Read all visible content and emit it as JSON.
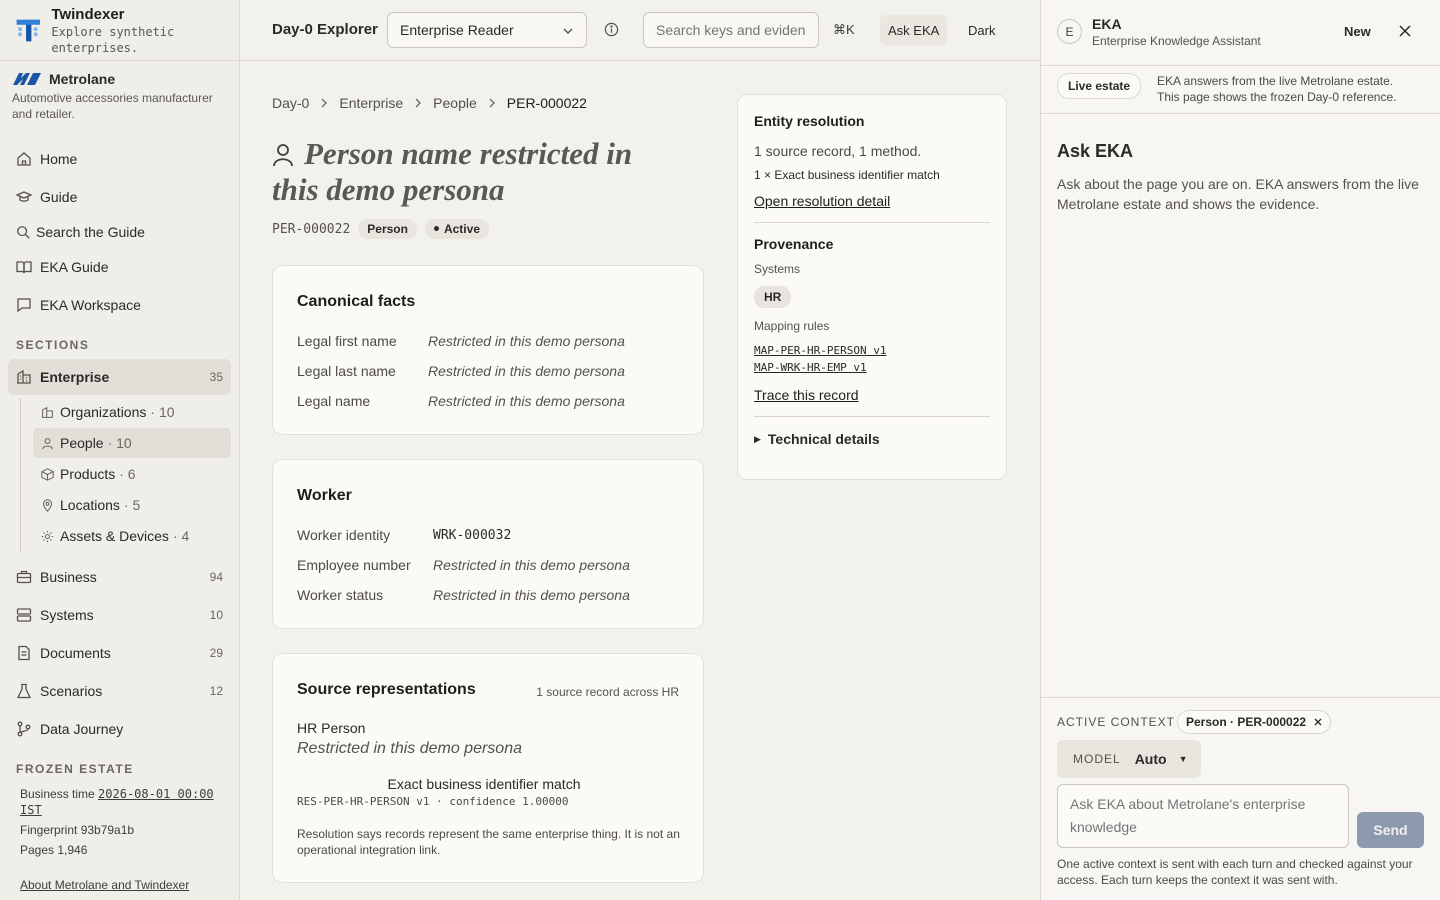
{
  "brand": {
    "name": "Twindexer",
    "tagline": "Explore synthetic enterprises."
  },
  "company": {
    "name": "Metrolane",
    "description": "Automotive accessories manufacturer and retailer."
  },
  "nav": {
    "home": "Home",
    "guide": "Guide",
    "search_guide": "Search the Guide",
    "eka_guide": "EKA Guide",
    "eka_workspace": "EKA Workspace"
  },
  "sections_label": "SECTIONS",
  "sections": {
    "enterprise": {
      "label": "Enterprise",
      "count": "35"
    },
    "organizations": {
      "label": "Organizations",
      "count": "· 10"
    },
    "people": {
      "label": "People",
      "count": "· 10"
    },
    "products": {
      "label": "Products",
      "count": "· 6"
    },
    "locations": {
      "label": "Locations",
      "count": "· 5"
    },
    "assets": {
      "label": "Assets & Devices",
      "count": "· 4"
    },
    "business": {
      "label": "Business",
      "count": "94"
    },
    "systems": {
      "label": "Systems",
      "count": "10"
    },
    "documents": {
      "label": "Documents",
      "count": "29"
    },
    "scenarios": {
      "label": "Scenarios",
      "count": "12"
    },
    "journey": {
      "label": "Data Journey"
    }
  },
  "frozen": {
    "label": "FROZEN ESTATE",
    "business_time_label": "Business time",
    "business_time": "2026-08-01 00:00 IST",
    "fingerprint": "Fingerprint 93b79a1b",
    "pages": "Pages 1,946",
    "about": "About Metrolane and Twindexer"
  },
  "topbar": {
    "title": "Day-0 Explorer",
    "persona": "Enterprise Reader",
    "search_placeholder": "Search keys and evidence",
    "shortcut": "⌘K",
    "ask": "Ask EKA",
    "dark": "Dark"
  },
  "breadcrumb": [
    "Day-0",
    "Enterprise",
    "People",
    "PER-000022"
  ],
  "page": {
    "title": "Person name restricted in this demo persona",
    "id": "PER-000022",
    "type_badge": "Person",
    "status_badge": "Active"
  },
  "canonical": {
    "title": "Canonical facts",
    "rows": [
      {
        "k": "Legal first name",
        "v": "Restricted in this demo persona"
      },
      {
        "k": "Legal last name",
        "v": "Restricted in this demo persona"
      },
      {
        "k": "Legal name",
        "v": "Restricted in this demo persona"
      }
    ]
  },
  "worker": {
    "title": "Worker",
    "rows": [
      {
        "k": "Worker identity",
        "v": "WRK-000032"
      },
      {
        "k": "Employee number",
        "v": "Restricted in this demo persona"
      },
      {
        "k": "Worker status",
        "v": "Restricted in this demo persona"
      }
    ]
  },
  "sources": {
    "title": "Source representations",
    "summary": "1 source record across HR",
    "record_name": "HR Person",
    "record_value": "Restricted in this demo persona",
    "match": "Exact business identifier match",
    "rule": "RES-PER-HR-PERSON v1 · confidence 1.00000",
    "note": "Resolution says records represent the same enterprise thing. It is not an operational integration link."
  },
  "resolution": {
    "title": "Entity resolution",
    "summary": "1 source record, 1 method.",
    "method": "1 × Exact business identifier match",
    "link": "Open resolution detail"
  },
  "provenance": {
    "title": "Provenance",
    "systems_label": "Systems",
    "system": "HR",
    "rules_label": "Mapping rules",
    "rules": [
      "MAP-PER-HR-PERSON v1",
      "MAP-WRK-HR-EMP v1"
    ],
    "trace": "Trace this record",
    "technical": "Technical details"
  },
  "eka": {
    "avatar": "E",
    "name": "EKA",
    "subtitle": "Enterprise Knowledge Assistant",
    "new": "New",
    "live_badge": "Live estate",
    "live_msg_1": "EKA answers from the live Metrolane estate.",
    "live_msg_2": "This page shows the frozen Day-0 reference.",
    "ask_title": "Ask EKA",
    "ask_desc": "Ask about the page you are on. EKA answers from the live Metrolane estate and shows the evidence.",
    "context_label": "ACTIVE CONTEXT",
    "context_chip": "Person · PER-000022",
    "model_label": "MODEL",
    "model_value": "Auto",
    "input_placeholder": "Ask EKA about Metrolane's enterprise knowledge",
    "send": "Send",
    "footer": "One active context is sent with each turn and checked against your access. Each turn keeps the context it was sent with."
  },
  "colors": {
    "accent": "#1f5fbf",
    "send_button": "#8d9aad",
    "panel": "#fbfaf7"
  }
}
